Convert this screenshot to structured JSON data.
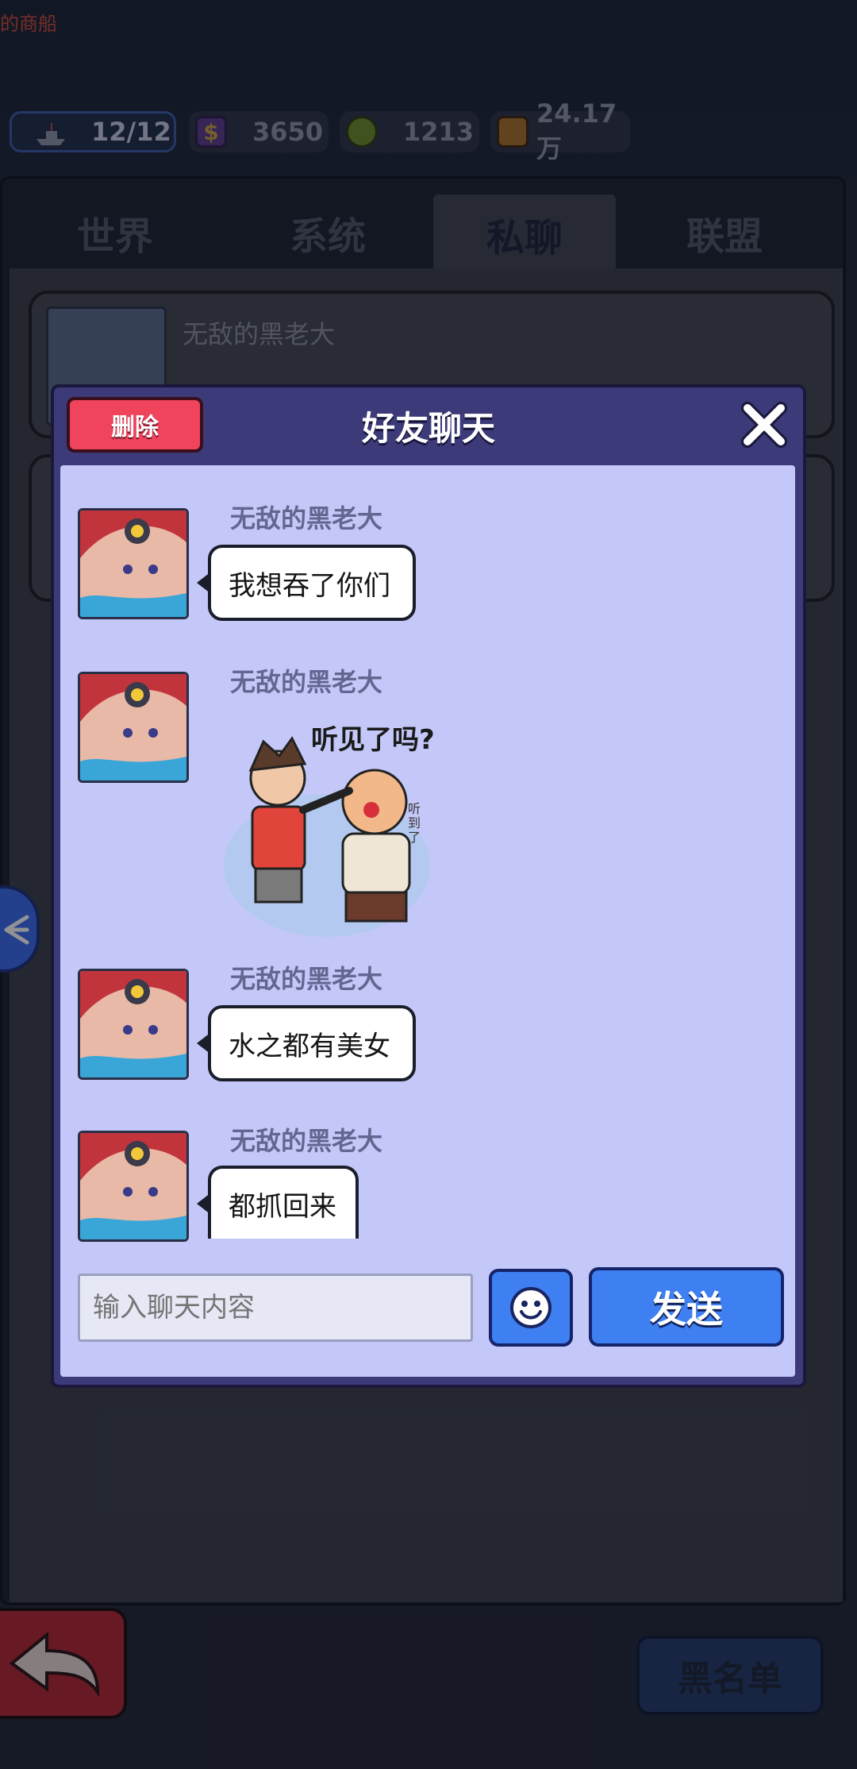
{
  "top_bar": {
    "top_label": "的商船",
    "resources": [
      {
        "icon": "ship-icon",
        "value": "12/12"
      },
      {
        "icon": "dollar-card-icon",
        "value": "3650"
      },
      {
        "icon": "coin-icon",
        "value": "1213"
      },
      {
        "icon": "fuel-can-icon",
        "value": "24.17万"
      }
    ]
  },
  "tabs": [
    {
      "label": "世界",
      "active": false
    },
    {
      "label": "系统",
      "active": false
    },
    {
      "label": "私聊",
      "active": true
    },
    {
      "label": "联盟",
      "active": false
    }
  ],
  "list": {
    "items": [
      {
        "name": "无敌的黑老大"
      }
    ]
  },
  "dialog": {
    "title": "好友聊天",
    "delete_label": "删除",
    "messages": [
      {
        "sender": "无敌的黑老大",
        "text": "我想吞了你们",
        "type": "text"
      },
      {
        "sender": "无敌的黑老大",
        "text": "听见了吗?",
        "type": "sticker",
        "sticker_side_text": "听到了"
      },
      {
        "sender": "无敌的黑老大",
        "text": "水之都有美女",
        "type": "text"
      },
      {
        "sender": "无敌的黑老大",
        "text": "都抓回来",
        "type": "text"
      }
    ],
    "input_placeholder": "输入聊天内容",
    "send_label": "发送"
  },
  "bottom": {
    "blacklist_label": "黑名单"
  },
  "colors": {
    "dialog_frame": "#3c3a78",
    "chat_bg": "#c4c8f8",
    "send_button": "#3e7ff2",
    "delete_button": "#f0435c"
  }
}
